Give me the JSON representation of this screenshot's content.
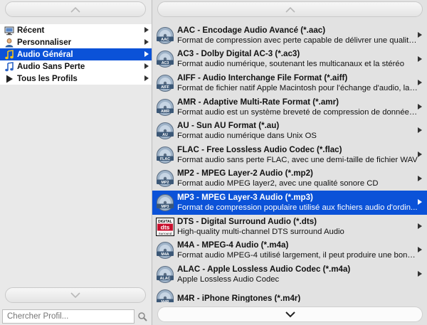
{
  "sidebar": {
    "items": [
      {
        "label": "Récent",
        "icon": "monitor-icon"
      },
      {
        "label": "Personnaliser",
        "icon": "user-icon"
      },
      {
        "label": "Audio Général",
        "icon": "music-note-icon",
        "selected": true
      },
      {
        "label": "Audio Sans Perte",
        "icon": "music-note-icon"
      },
      {
        "label": "Tous les Profils",
        "icon": "play-triangle-icon"
      }
    ],
    "search_placeholder": "Chercher Profil..."
  },
  "formats": [
    {
      "title": "AAC - Encodage Audio Avancé (*.aac)",
      "desc": "Format de compression avec perte capable de délivrer une qualité...",
      "icon": "aac-icon"
    },
    {
      "title": "AC3 - Dolby Digital AC-3 (*.ac3)",
      "desc": "Format audio numérique, soutenant les multicanaux et la stéréo",
      "icon": "ac3-icon"
    },
    {
      "title": "AIFF - Audio Interchange File Format (*.aiff)",
      "desc": "Format de fichier natif Apple Macintosh pour l'échange d'audio, lar...",
      "icon": "aiff-icon"
    },
    {
      "title": "AMR - Adaptive Multi-Rate Format (*.amr)",
      "desc": "Format audio est un système breveté de compression de données ...",
      "icon": "amr-icon"
    },
    {
      "title": "AU - Sun AU Format (*.au)",
      "desc": "Format audio numérique dans Unix OS",
      "icon": "au-icon"
    },
    {
      "title": "FLAC - Free Lossless Audio Codec (*.flac)",
      "desc": "Format audio sans perte FLAC, avec une demi-taille de fichier WAV",
      "icon": "flac-icon"
    },
    {
      "title": "MP2 - MPEG Layer-2 Audio (*.mp2)",
      "desc": "Format audio MPEG layer2, avec une qualité sonore CD",
      "icon": "mp2-icon"
    },
    {
      "title": "MP3 - MPEG Layer-3 Audio (*.mp3)",
      "desc": "Format de compression populaire utilisé aux fichiers audio d'ordin...",
      "icon": "mp3-icon",
      "selected": true
    },
    {
      "title": "DTS - Digital Surround Audio (*.dts)",
      "desc": "High-quality multi-channel DTS surround Audio",
      "icon": "dts-logo-icon"
    },
    {
      "title": "M4A - MPEG-4 Audio (*.m4a)",
      "desc": "Format audio MPEG-4 utilisé largement, il peut produire une bonn...",
      "icon": "m4a-icon"
    },
    {
      "title": "ALAC - Apple Lossless Audio Codec (*.m4a)",
      "desc": "Apple Lossless Audio Codec",
      "icon": "alac-icon"
    },
    {
      "title": "M4R - iPhone Ringtones (*.m4r)",
      "desc": "",
      "icon": "m4r-icon"
    }
  ],
  "icon_labels": {
    "aac": "AAC",
    "ac3": "AC3",
    "aiff": "AIFF",
    "amr": "AMR",
    "au": "AU",
    "flac": "FLAC",
    "mp2": "MP2",
    "mp3": "MP3",
    "dts_top": "DIGITAL",
    "dts_mid": "dts",
    "dts_bot": "Surround",
    "m4a": "M4A",
    "alac": "ALAC",
    "m4r": "M4R"
  },
  "colors": {
    "selection": "#0b52d8",
    "background": "#e2e2e2"
  }
}
